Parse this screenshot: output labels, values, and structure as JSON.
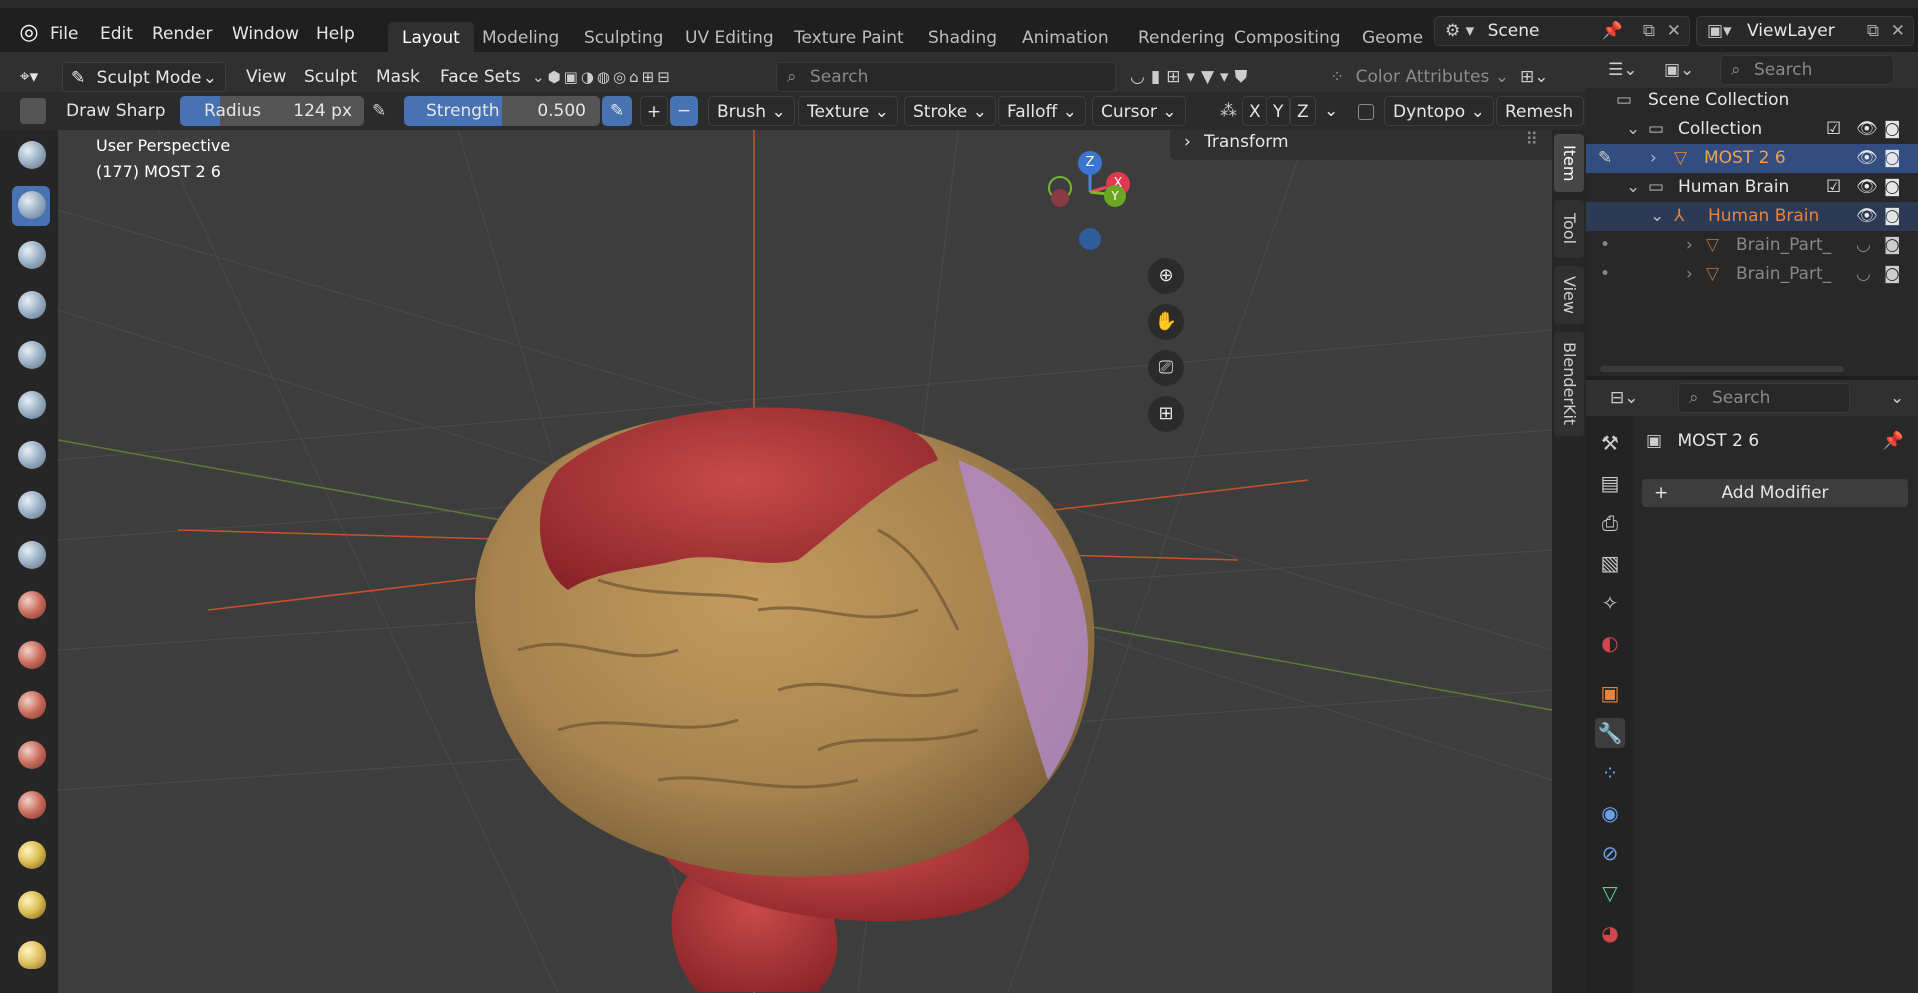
{
  "menu": {
    "file": "File",
    "edit": "Edit",
    "render": "Render",
    "window": "Window",
    "help": "Help"
  },
  "workspaces": [
    "Layout",
    "Modeling",
    "Sculpting",
    "UV Editing",
    "Texture Paint",
    "Shading",
    "Animation",
    "Rendering",
    "Compositing",
    "Geome"
  ],
  "scene": {
    "name": "Scene",
    "viewlayer": "ViewLayer"
  },
  "header": {
    "mode": "Sculpt Mode",
    "menus": [
      "View",
      "Sculpt",
      "Mask",
      "Face Sets"
    ],
    "search_placeholder": "Search",
    "color_attributes": "Color Attributes"
  },
  "toolsettings": {
    "brush_name": "Draw Sharp",
    "radius_label": "Radius",
    "radius_value": "124 px",
    "strength_label": "Strength",
    "strength_value": "0.500",
    "plus": "+",
    "minus": "−",
    "brush": "Brush",
    "texture": "Texture",
    "stroke": "Stroke",
    "falloff": "Falloff",
    "cursor": "Cursor",
    "axes": [
      "X",
      "Y",
      "Z"
    ],
    "dyntopo": "Dyntopo",
    "remesh": "Remesh"
  },
  "viewport": {
    "perspective": "User Perspective",
    "object_info": "(177) MOST 2 6",
    "transform": "Transform",
    "gizmo": {
      "z": "Z",
      "x": "X",
      "y": "Y"
    }
  },
  "sidebar_tabs": [
    "Item",
    "Tool",
    "View",
    "BlenderKit"
  ],
  "outliner": {
    "search_placeholder": "Search",
    "scene_collection": "Scene Collection",
    "rows": [
      {
        "label": "Collection",
        "level": 1
      },
      {
        "label": "MOST 2 6",
        "level": 2
      },
      {
        "label": "Human Brain",
        "level": 1
      },
      {
        "label": "Human Brain",
        "level": 2
      },
      {
        "label": "Brain_Part_",
        "level": 3
      },
      {
        "label": "Brain_Part_",
        "level": 3
      }
    ]
  },
  "properties": {
    "search_placeholder": "Search",
    "object_name": "MOST 2 6",
    "add_modifier": "Add Modifier"
  },
  "colors": {
    "accent": "#4772b3",
    "orange": "#e8833a",
    "brain_tan": "#a6834f",
    "brain_red": "#b2353a",
    "brain_purple": "#b08ac4"
  }
}
